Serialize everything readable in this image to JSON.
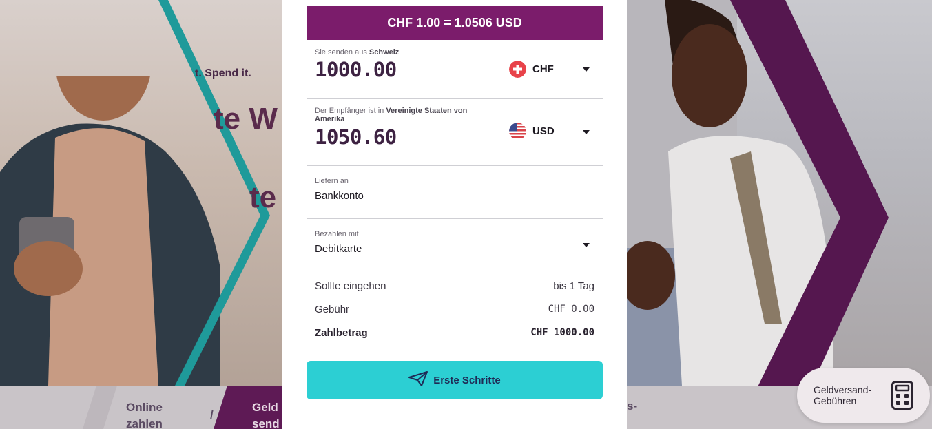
{
  "background": {
    "headline_tagline": "t. Spend it.",
    "headline_fragment_1": "te W",
    "headline_fragment_2": "te",
    "bottom_tabs": [
      {
        "label_line1": "Online",
        "label_line2": "zahlen"
      },
      {
        "separator": "/"
      },
      {
        "label_line1": "Geld",
        "label_line2": "send"
      },
      {
        "label_line1": "s-",
        "label_line2": ""
      }
    ],
    "colors": {
      "brand_purple": "#7b1c6b",
      "teal_accent": "#1f9a9a"
    }
  },
  "modal": {
    "rate": "CHF 1.00 = 1.0506 USD",
    "send": {
      "label_prefix": "Sie senden aus ",
      "label_country": "Schweiz",
      "amount": "1000.00",
      "currency": "CHF",
      "flag_icon": "switzerland-flag-icon"
    },
    "receive": {
      "label_prefix": "Der Empfänger ist in ",
      "label_country": "Vereinigte Staaten von Amerika",
      "amount": "1050.60",
      "currency": "USD",
      "flag_icon": "usa-flag-icon"
    },
    "deliver": {
      "label": "Liefern an",
      "value": "Bankkonto"
    },
    "pay": {
      "label": "Bezahlen mit",
      "value": "Debitkarte"
    },
    "summary": [
      {
        "label": "Sollte eingehen",
        "value": "bis 1 Tag"
      },
      {
        "label": "Gebühr",
        "value": "CHF 0.00"
      },
      {
        "label": "Zahlbetrag",
        "value": "CHF 1000.00"
      }
    ],
    "cta_label": "Erste Schritte",
    "cta_icon": "paper-plane-icon",
    "colors": {
      "cta": "#2ccfd3",
      "rate_bar": "#7b1c6b",
      "amount": "#3d2242"
    }
  },
  "calculator": {
    "label": "Geldversand-Gebühren",
    "icon": "calculator-icon"
  }
}
